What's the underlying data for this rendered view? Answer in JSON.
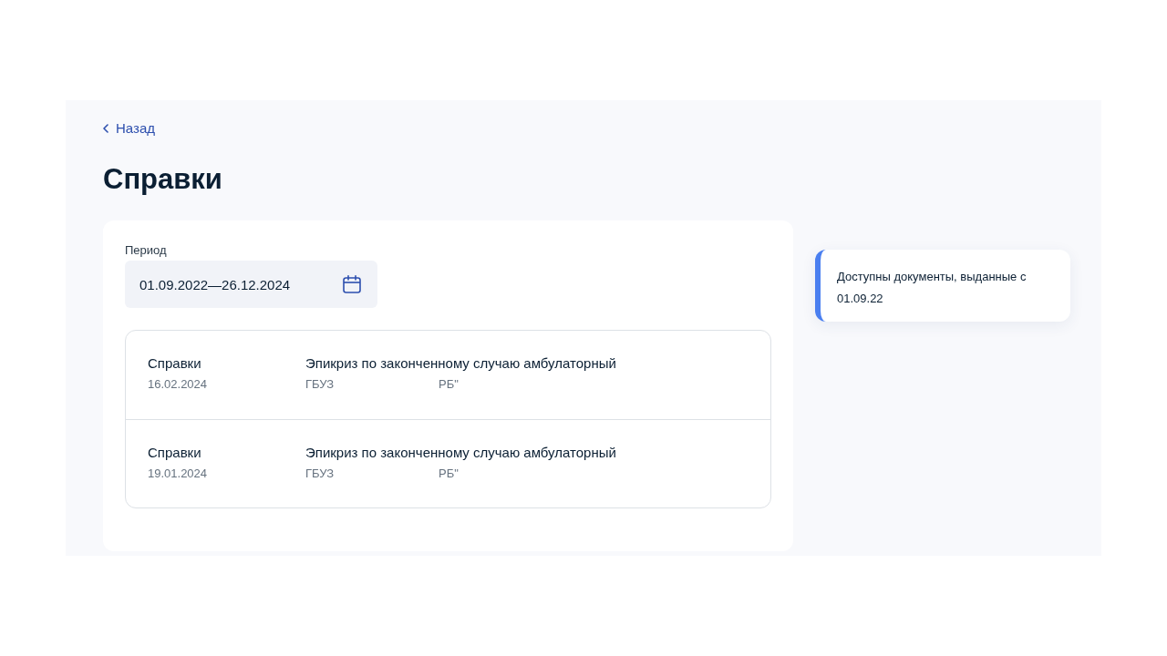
{
  "back_link": {
    "label": "Назад"
  },
  "title": "Справки",
  "period": {
    "label": "Период",
    "value": "01.09.2022—26.12.2024"
  },
  "documents": [
    {
      "category": "Справки",
      "date": "16.02.2024",
      "name": "Эпикриз по законченному случаю амбулаторный",
      "organization_start": "ГБУЗ",
      "organization_end": "РБ\""
    },
    {
      "category": "Справки",
      "date": "19.01.2024",
      "name": "Эпикриз по законченному случаю амбулаторный",
      "organization_start": "ГБУЗ",
      "organization_end": "РБ\""
    }
  ],
  "notice": {
    "text": "Доступны документы, выданные с 01.09.22"
  }
}
